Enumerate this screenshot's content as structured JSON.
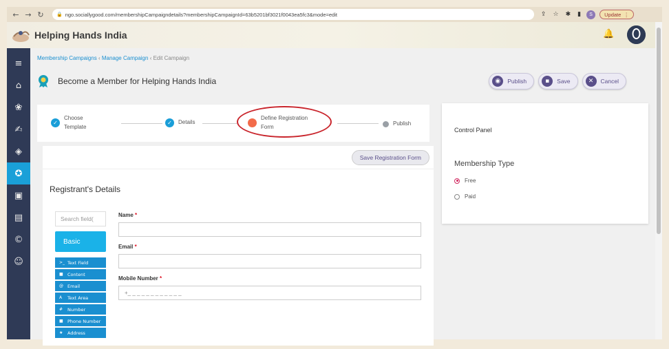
{
  "browser": {
    "url": "ngo.sociallygood.com/membershipCampaigndetails?membershipCampaignId=63b5201bf3021f0043ea5fc3&mode=edit",
    "profile_initial": "S",
    "update_label": "Update"
  },
  "header": {
    "brand": "Helping Hands India"
  },
  "breadcrumb": {
    "item1": "Membership Campaigns",
    "sep": "‹",
    "item2": "Manage Campaign",
    "item3": "Edit Campaign"
  },
  "page": {
    "title": "Become a Member for Helping Hands India"
  },
  "actions": {
    "publish": "Publish",
    "save": "Save",
    "cancel": "Cancel"
  },
  "stepper": {
    "step1_line1": "Choose",
    "step1_line2": "Template",
    "step2": "Details",
    "step3_line1": "Define Registration",
    "step3_line2": "Form",
    "step4": "Publish"
  },
  "form": {
    "save_registration": "Save Registration Form",
    "section_title": "Registrant's Details",
    "search_placeholder": "Search field(",
    "basic_label": "Basic",
    "field_types": [
      "Text Field",
      "Content",
      "Email",
      "Text Area",
      "Number",
      "Phone Number",
      "Address"
    ],
    "field_icons": [
      ">_",
      "■",
      "@",
      "A",
      "#",
      "■",
      "★"
    ],
    "name_label": "Name",
    "email_label": "Email",
    "mobile_label": "Mobile Number",
    "mobile_placeholder": "+_ _ _ _ _ _ _ _ _ _ _ _",
    "required_mark": "*"
  },
  "control_panel": {
    "title": "Control Panel",
    "membership_type": "Membership Type",
    "option_free": "Free",
    "option_paid": "Paid",
    "selected": "Free"
  },
  "colors": {
    "accent": "#1a9ed8",
    "sidebar": "#2f3a56",
    "current_step": "#f26b4a",
    "annotation": "#c9252c"
  }
}
